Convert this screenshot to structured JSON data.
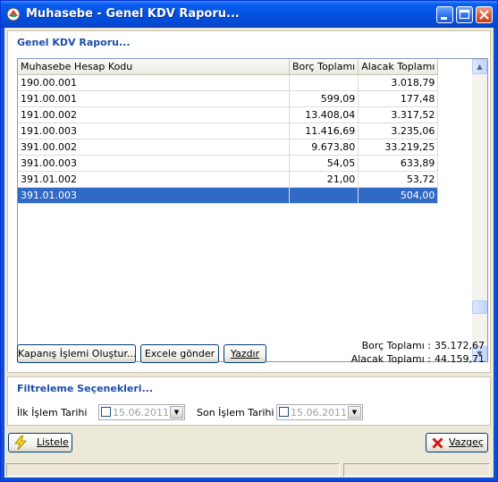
{
  "window": {
    "title": "Muhasebe - Genel KDV Raporu..."
  },
  "report_group": {
    "title": "Genel KDV Raporu..."
  },
  "grid": {
    "columns": [
      "Muhasebe Hesap Kodu",
      "Borç Toplamı",
      "Alacak Toplamı"
    ],
    "rows": [
      {
        "code": "190.00.001",
        "borc": "",
        "alacak": "3.018,79"
      },
      {
        "code": "191.00.001",
        "borc": "599,09",
        "alacak": "177,48"
      },
      {
        "code": "191.00.002",
        "borc": "13.408,04",
        "alacak": "3.317,52"
      },
      {
        "code": "191.00.003",
        "borc": "11.416,69",
        "alacak": "3.235,06"
      },
      {
        "code": "391.00.002",
        "borc": "9.673,80",
        "alacak": "33.219,25"
      },
      {
        "code": "391.00.003",
        "borc": "54,05",
        "alacak": "633,89"
      },
      {
        "code": "391.01.002",
        "borc": "21,00",
        "alacak": "53,72"
      },
      {
        "code": "391.01.003",
        "borc": "",
        "alacak": "504,00"
      }
    ],
    "selected_index": 7
  },
  "actions": {
    "kapanis_label": "Kapanış İşlemi Oluştur...",
    "excel_label": "Excele gönder",
    "yazdir_label": "Yazdır"
  },
  "totals": {
    "borc_label": "Borç Toplamı :",
    "borc_value": "35.172,67",
    "alacak_label": "Alacak Toplamı :",
    "alacak_value": "44.159,71"
  },
  "filter_group": {
    "title": "Filtreleme Seçenekleri...",
    "start_label": "İlk İşlem Tarihi",
    "start_value": "15.06.2011",
    "end_label": "Son İşlem Tarihi",
    "end_value": "15.06.2011"
  },
  "footer": {
    "listele_label": "Listele",
    "vazgec_label": "Vazgeç"
  },
  "colors": {
    "titlebar": "#0552e0",
    "selection": "#316ac5",
    "group_title": "#1c4ea5",
    "dialog_bg": "#ece9d8"
  },
  "icons": [
    "app-icon",
    "minimize-icon",
    "maximize-icon",
    "close-icon",
    "lightning-icon",
    "red-x-icon",
    "calendar-dropdown-icon",
    "scroll-up-icon",
    "scroll-down-icon"
  ]
}
